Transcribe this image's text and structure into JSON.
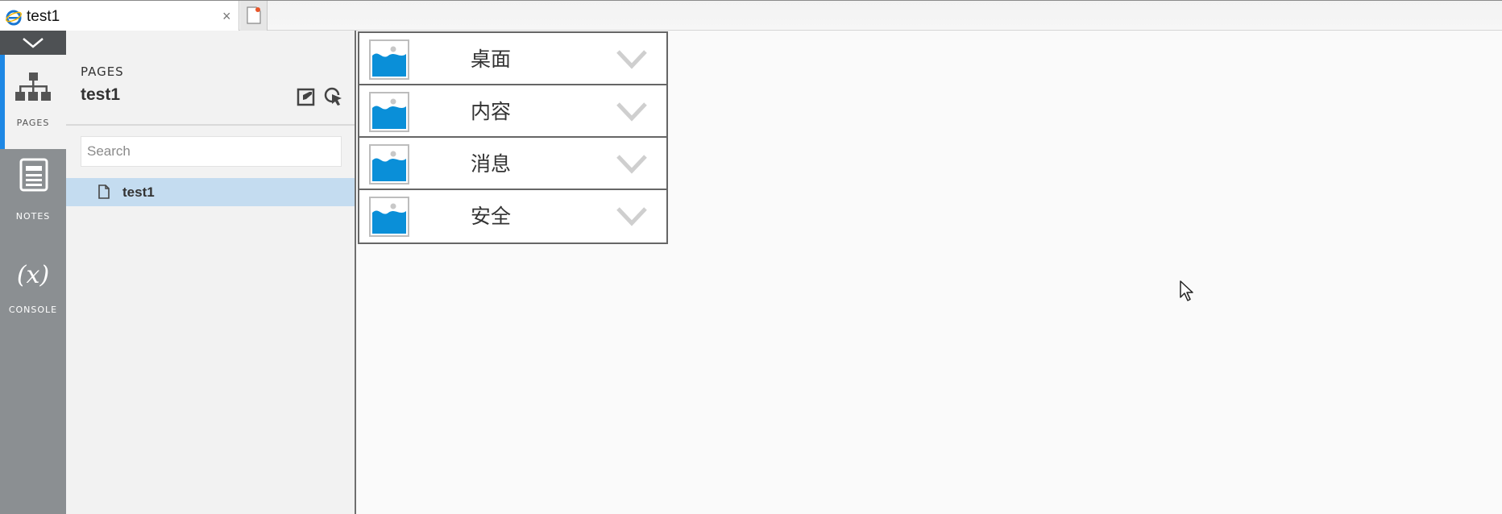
{
  "browser": {
    "tab_title": "test1",
    "tab_close": "×"
  },
  "rail": {
    "items": [
      {
        "label": "PAGES",
        "icon": "sitemap-icon"
      },
      {
        "label": "NOTES",
        "icon": "notes-icon"
      },
      {
        "label": "CONSOLE",
        "symbol": "(x)"
      }
    ]
  },
  "pages_panel": {
    "heading": "PAGES",
    "title": "test1",
    "search_placeholder": "Search",
    "pages": [
      {
        "label": "test1"
      }
    ]
  },
  "menu": {
    "items": [
      {
        "label": "桌面"
      },
      {
        "label": "内容"
      },
      {
        "label": "消息"
      },
      {
        "label": "安全"
      }
    ]
  },
  "colors": {
    "accent": "#1e88e5",
    "rail": "#8b8f92",
    "selected_row": "#c4dcf0",
    "image_blue": "#0a8fd8"
  }
}
